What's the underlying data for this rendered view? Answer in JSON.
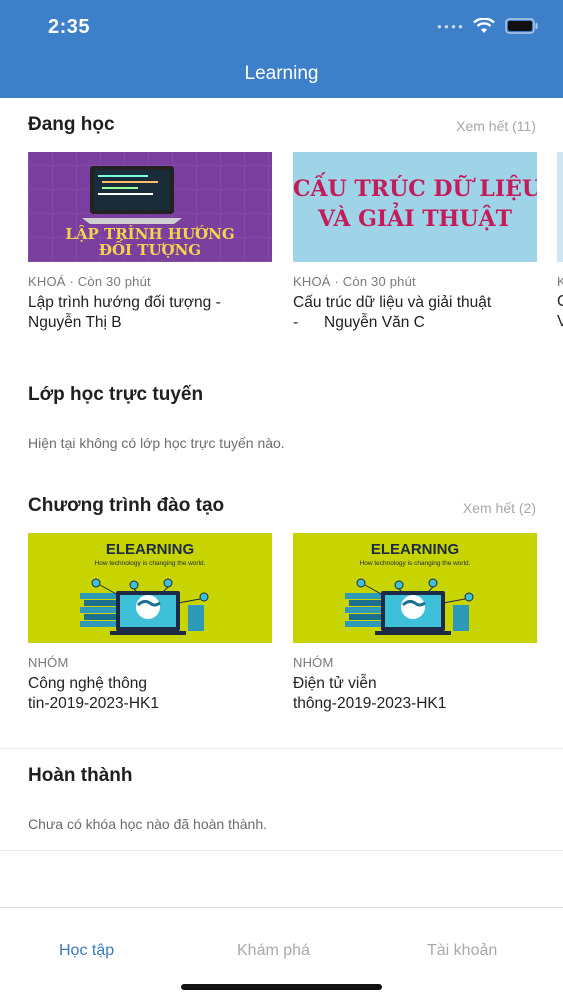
{
  "status_bar": {
    "time": "2:35"
  },
  "header": {
    "title": "Learning"
  },
  "studying": {
    "title": "Đang học",
    "see_all": "Xem hết (11)",
    "courses": [
      {
        "meta": "KHOÁ · Còn 30 phút",
        "title": "Lập trình hướng đối tượng -\nNguyễn Thị B",
        "art": "LẬP TRÌNH HƯỚNG\nĐỐI TƯỢNG"
      },
      {
        "meta": "KHOÁ · Còn 30 phút",
        "title": "Cấu trúc dữ liệu và giải thuật\n-      Nguyễn Văn C",
        "art": "CẤU TRÚC DỮ LIỆU\nVÀ GIẢI THUẬT"
      }
    ],
    "peek_meta": "K",
    "peek_title": "C\nV"
  },
  "online_class": {
    "title": "Lớp học trực tuyến",
    "empty": "Hiện tại không có lớp học trực tuyến nào."
  },
  "training": {
    "title": "Chương trình đào tạo",
    "see_all": "Xem hết (2)",
    "programs": [
      {
        "meta": "NHÓM",
        "title": "Công nghệ thông\ntin-2019-2023-HK1",
        "art_title": "ELEARNING",
        "art_sub": "How technology is changing the world."
      },
      {
        "meta": "NHÓM",
        "title": "Điện tử viễn\nthông-2019-2023-HK1",
        "art_title": "ELEARNING",
        "art_sub": "How technology is changing the world."
      }
    ]
  },
  "completed": {
    "title": "Hoàn thành",
    "empty": "Chưa có khóa học nào đã hoàn thành."
  },
  "tabbar": {
    "tabs": [
      {
        "label": "Học tập",
        "active": true
      },
      {
        "label": "Khám phá",
        "active": false
      },
      {
        "label": "Tài khoản",
        "active": false
      }
    ]
  },
  "colors": {
    "header": "#3d7fc8",
    "active_tab": "#3a7ac2",
    "elearning_bg": "#c8d400"
  }
}
